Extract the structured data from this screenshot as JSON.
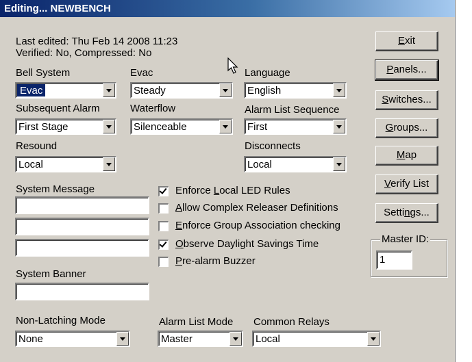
{
  "window": {
    "title": "Editing... NEWBENCH"
  },
  "info": {
    "last_edited": "Last edited: Thu Feb 14 2008 11:23",
    "verified": "Verified: No,  Compressed: No"
  },
  "fields": {
    "bell_system": {
      "label": "Bell System",
      "value": "Evac"
    },
    "evac": {
      "label": "Evac",
      "value": "Steady"
    },
    "language": {
      "label": "Language",
      "value": "English"
    },
    "subsequent_alarm": {
      "label": "Subsequent Alarm",
      "value": "First Stage"
    },
    "waterflow": {
      "label": "Waterflow",
      "value": "Silenceable"
    },
    "alarm_list_sequence": {
      "label": "Alarm List Sequence",
      "value": "First"
    },
    "resound": {
      "label": "Resound",
      "value": "Local"
    },
    "disconnects": {
      "label": "Disconnects",
      "value": "Local"
    },
    "non_latching_mode": {
      "label": "Non-Latching Mode",
      "value": "None"
    },
    "alarm_list_mode": {
      "label": "Alarm List Mode",
      "value": "Master"
    },
    "common_relays": {
      "label": "Common Relays",
      "value": "Local"
    }
  },
  "system_message": {
    "label": "System Message",
    "lines": [
      "",
      "",
      ""
    ]
  },
  "system_banner": {
    "label": "System Banner",
    "value": ""
  },
  "checkboxes": [
    {
      "pre": "Enforce ",
      "key": "L",
      "post": "ocal LED Rules",
      "checked": true
    },
    {
      "pre": "",
      "key": "A",
      "post": "llow Complex Releaser Definitions",
      "checked": false
    },
    {
      "pre": "",
      "key": "E",
      "post": "nforce Group Association checking",
      "checked": false
    },
    {
      "pre": "",
      "key": "O",
      "post": "bserve Daylight Savings Time",
      "checked": true
    },
    {
      "pre": "",
      "key": "P",
      "post": "re-alarm Buzzer",
      "checked": false
    }
  ],
  "buttons": [
    {
      "pre": "",
      "key": "E",
      "post": "xit"
    },
    {
      "pre": "",
      "key": "P",
      "post": "anels..."
    },
    {
      "pre": "",
      "key": "S",
      "post": "witches..."
    },
    {
      "pre": "",
      "key": "G",
      "post": "roups..."
    },
    {
      "pre": "",
      "key": "M",
      "post": "ap"
    },
    {
      "pre": "",
      "key": "V",
      "post": "erify List"
    },
    {
      "pre": "Setti",
      "key": "n",
      "post": "gs..."
    }
  ],
  "master_id": {
    "label": "Master ID:",
    "value": "1"
  },
  "icons": {
    "cursor": "mouse-pointer-icon",
    "dropdown": "chevron-down-icon",
    "check": "checkmark-icon"
  },
  "colors": {
    "title_start": "#0a246a",
    "title_end": "#a6caf0",
    "face": "#d4d0c8",
    "selection": "#0a246a"
  }
}
